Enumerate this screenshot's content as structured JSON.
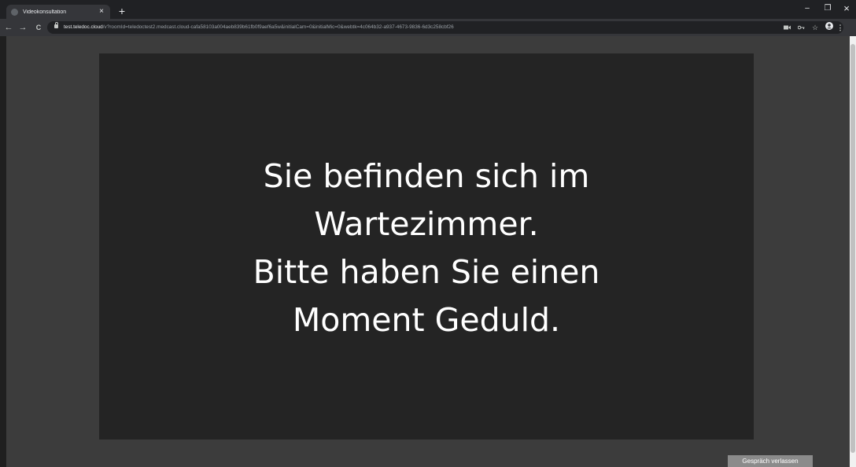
{
  "browser": {
    "tab_title": "Videokonsultation",
    "tab_close": "×",
    "new_tab": "+",
    "url_host": "test.teledoc.cloud",
    "url_path": "/v?roomId=teledoctest2.medcast.cloud-cafa58103a004aeb839b61fb0f9aef6a5w&initialCam=0&initialMic=0&webtk=4c064b32-a937-4673-9836-6d3c258cbf26",
    "minimize": "–",
    "restore": "❐",
    "close": "×",
    "back": "←",
    "forward": "→",
    "reload": "C",
    "icons": [
      "camera-icon",
      "key-icon",
      "star-icon",
      "profile-icon",
      "menu-icon"
    ]
  },
  "page": {
    "waiting_lines": [
      "Sie befinden sich im",
      "Wartezimmer.",
      "Bitte haben Sie einen",
      "Moment Geduld."
    ],
    "leave_button": "Gespräch verlassen"
  },
  "colors": {
    "background": "#3c3c3c",
    "panel": "#242424",
    "button": "#8b8b8b"
  }
}
